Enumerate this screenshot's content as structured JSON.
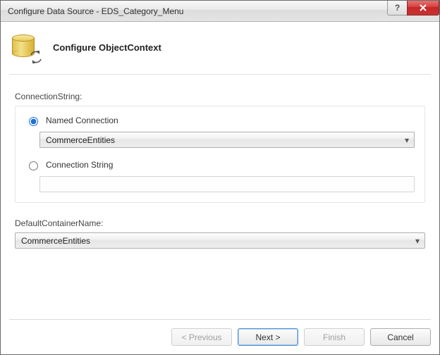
{
  "window": {
    "title": "Configure Data Source - EDS_Category_Menu"
  },
  "page": {
    "heading": "Configure ObjectContext"
  },
  "connection": {
    "label": "ConnectionString:",
    "named_option": "Named Connection",
    "named_selected": "CommerceEntities",
    "string_option": "Connection String",
    "string_value": ""
  },
  "container": {
    "label": "DefaultContainerName:",
    "selected": "CommerceEntities"
  },
  "buttons": {
    "previous": "< Previous",
    "next": "Next >",
    "finish": "Finish",
    "cancel": "Cancel"
  }
}
